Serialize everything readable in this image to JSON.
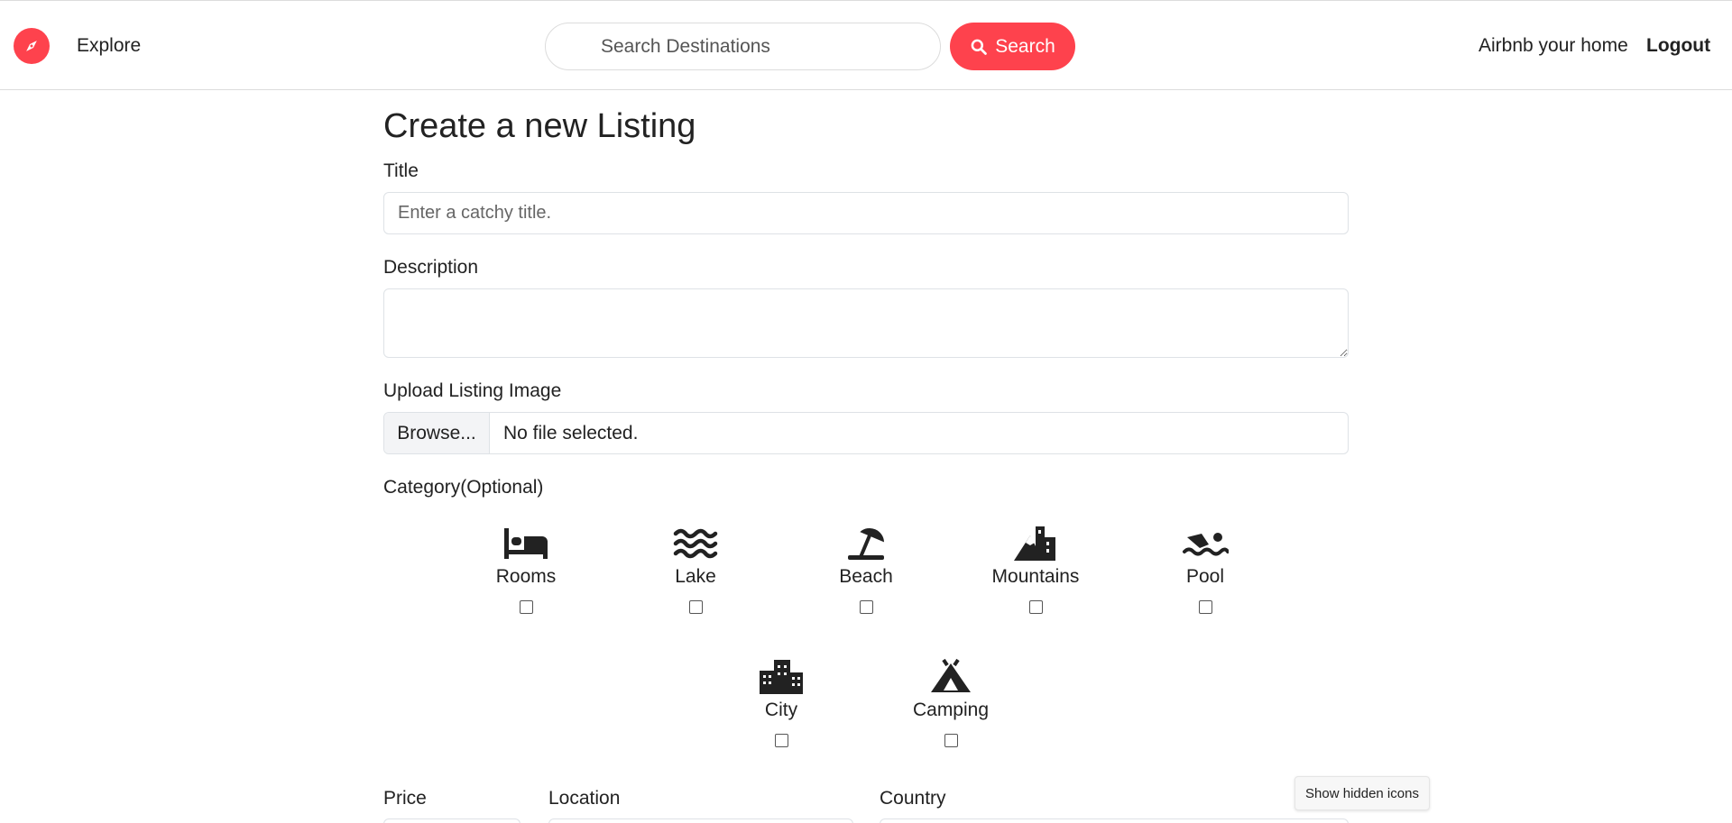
{
  "nav": {
    "explore": "Explore",
    "search_placeholder": "Search Destinations",
    "search_button": "Search",
    "host": "Airbnb your home",
    "logout": "Logout",
    "accent_color": "#fe424d"
  },
  "form": {
    "heading": "Create a new Listing",
    "title_label": "Title",
    "title_placeholder": "Enter a catchy title.",
    "description_label": "Description",
    "image_label": "Upload Listing Image",
    "browse_button": "Browse...",
    "file_status": "No file selected.",
    "category_label": "Category(Optional)",
    "categories": [
      {
        "label": "Rooms",
        "icon": "bed-icon"
      },
      {
        "label": "Lake",
        "icon": "water-icon"
      },
      {
        "label": "Beach",
        "icon": "umbrella-beach-icon"
      },
      {
        "label": "Mountains",
        "icon": "mountain-city-icon"
      },
      {
        "label": "Pool",
        "icon": "person-swimming-icon"
      },
      {
        "label": "City",
        "icon": "city-icon"
      },
      {
        "label": "Camping",
        "icon": "campground-icon"
      }
    ],
    "price_label": "Price",
    "location_label": "Location",
    "country_label": "Country"
  },
  "system": {
    "tooltip": "Show hidden icons"
  }
}
